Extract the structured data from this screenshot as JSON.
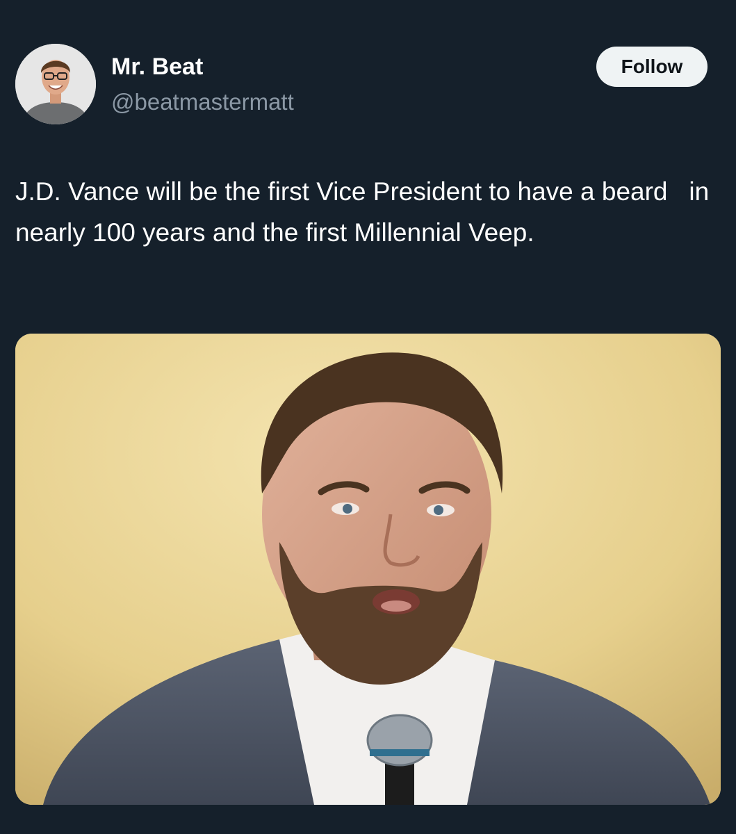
{
  "tweet": {
    "author": {
      "display_name": "Mr. Beat",
      "handle": "@beatmastermatt",
      "avatar_icon": "profile-photo"
    },
    "follow_label": "Follow",
    "text": "J.D. Vance will be the first Vice President to have a beard   in nearly 100 years and the first Millennial Veep.",
    "media": {
      "kind": "photo"
    }
  },
  "colors": {
    "background": "#15202b",
    "primary_text": "#ffffff",
    "secondary_text": "#8b98a5",
    "follow_button_bg": "#eff3f4",
    "follow_button_text": "#0f1419"
  }
}
